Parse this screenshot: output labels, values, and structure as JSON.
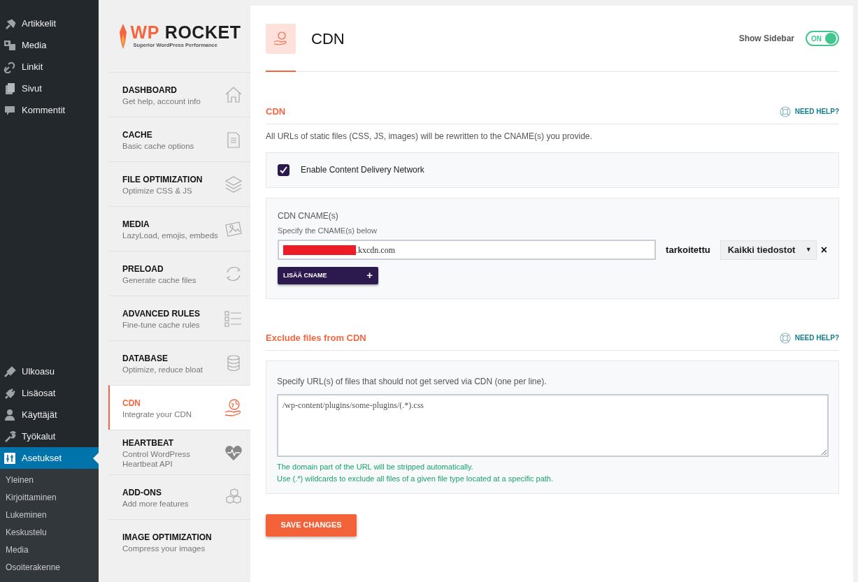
{
  "wp_menu": {
    "top_items": [
      {
        "label": "Artikkelit",
        "selected": false
      },
      {
        "label": "Media",
        "selected": false
      },
      {
        "label": "Linkit",
        "selected": false
      },
      {
        "label": "Sivut",
        "selected": false
      },
      {
        "label": "Kommentit",
        "selected": false
      }
    ],
    "bottom_items": [
      {
        "label": "Ulkoasu",
        "selected": false
      },
      {
        "label": "Lisäosat",
        "selected": false
      },
      {
        "label": "Käyttäjät",
        "selected": false
      },
      {
        "label": "Työkalut",
        "selected": false
      },
      {
        "label": "Asetukset",
        "selected": true
      }
    ],
    "submenu": [
      {
        "label": "Yleinen"
      },
      {
        "label": "Kirjoittaminen"
      },
      {
        "label": "Lukeminen"
      },
      {
        "label": "Keskustelu"
      },
      {
        "label": "Media"
      },
      {
        "label": "Osoiterakenne"
      }
    ]
  },
  "plugin": {
    "logo": {
      "accent": "WP",
      "name": "ROCKET",
      "tagline": "Superior WordPress Performance"
    },
    "nav": [
      {
        "title": "DASHBOARD",
        "subtitle": "Get help, account info",
        "selected": false
      },
      {
        "title": "CACHE",
        "subtitle": "Basic cache options",
        "selected": false
      },
      {
        "title": "FILE OPTIMIZATION",
        "subtitle": "Optimize CSS & JS",
        "selected": false
      },
      {
        "title": "MEDIA",
        "subtitle": "LazyLoad, emojis, embeds",
        "selected": false
      },
      {
        "title": "PRELOAD",
        "subtitle": "Generate cache files",
        "selected": false
      },
      {
        "title": "ADVANCED RULES",
        "subtitle": "Fine-tune cache rules",
        "selected": false
      },
      {
        "title": "DATABASE",
        "subtitle": "Optimize, reduce bloat",
        "selected": false
      },
      {
        "title": "CDN",
        "subtitle": "Integrate your CDN",
        "selected": true
      },
      {
        "title": "HEARTBEAT",
        "subtitle": "Control WordPress Heartbeat API",
        "selected": false
      },
      {
        "title": "ADD-ONS",
        "subtitle": "Add more features",
        "selected": false
      },
      {
        "title": "IMAGE OPTIMIZATION",
        "subtitle": "Compress your images",
        "selected": false
      }
    ]
  },
  "page": {
    "title": "CDN",
    "sidebar_toggle": {
      "label": "Show Sidebar",
      "text": "ON",
      "on": true
    }
  },
  "cdn_section": {
    "heading": "CDN",
    "help": "NEED HELP?",
    "description": "All URLs of static files (CSS, JS, images) will be rewritten to the CNAME(s) you provide.",
    "enable_checkbox": {
      "label": "Enable Content Delivery Network",
      "checked": true
    },
    "cnames": {
      "title": "CDN CNAME(s)",
      "hint": "Specify the CNAME(s) below",
      "rows": [
        {
          "value": ".kxcdn.com",
          "redacted": true,
          "connector": "tarkoitettu",
          "select": "Kaikki tiedostot",
          "caret": "▼",
          "remove": "×"
        }
      ],
      "add_button": "LISÄÄ CNAME",
      "add_icon": "+"
    }
  },
  "exclude_section": {
    "heading": "Exclude files from CDN",
    "help": "NEED HELP?",
    "hint": "Specify URL(s) of files that should not get served via CDN (one per line).",
    "placeholder": "/wp-content/plugins/some-plugins/(.*).css",
    "notes": [
      "The domain part of the URL will be stripped automatically.",
      "Use (.*) wildcards to exclude all files of a given file type located at a specific path."
    ]
  },
  "save_button": "SAVE CHANGES"
}
